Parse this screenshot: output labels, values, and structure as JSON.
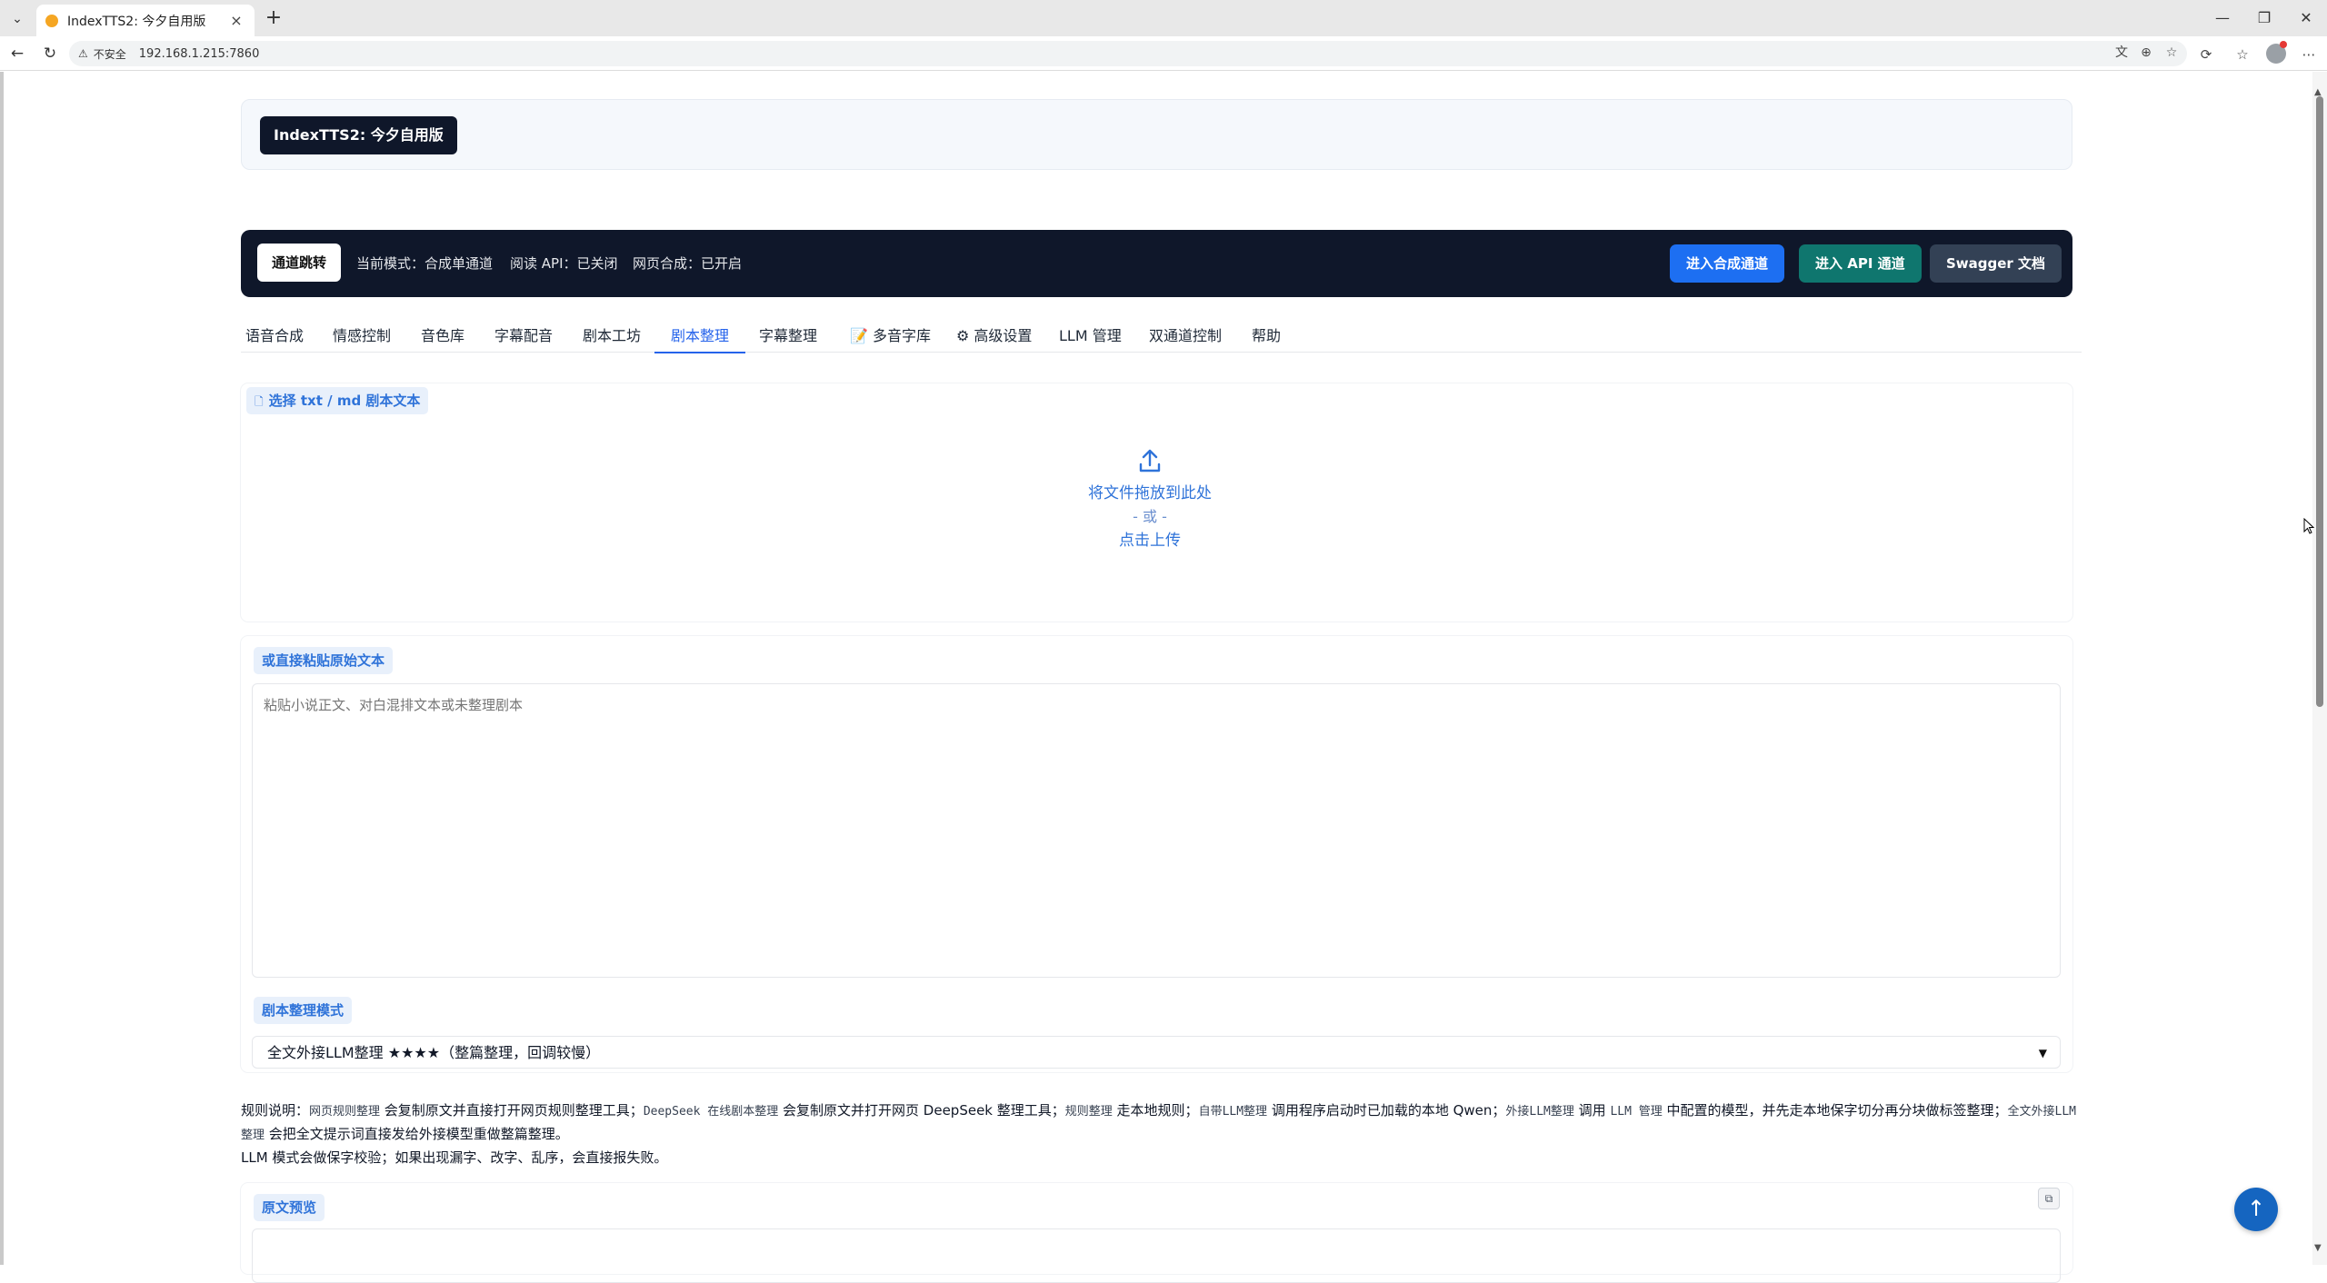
{
  "browser": {
    "tab_title": "IndexTTS2: 今夕自用版",
    "tab_close": "×",
    "new_tab": "+",
    "minimize": "—",
    "restore": "❐",
    "close": "✕",
    "insecure_label": "不安全",
    "url": "192.168.1.215:7860"
  },
  "header": {
    "brand": "IndexTTS2: 今夕自用版"
  },
  "channel_bar": {
    "jump_label": "通道跳转",
    "mode_text": "当前模式：合成单通道",
    "read_api_text": "阅读 API：已关闭",
    "web_synth_text": "网页合成：已开启",
    "btn_synth": "进入合成通道",
    "btn_api": "进入 API 通道",
    "btn_swagger": "Swagger 文档"
  },
  "tabs": [
    {
      "label": "语音合成"
    },
    {
      "label": "情感控制"
    },
    {
      "label": "音色库"
    },
    {
      "label": "字幕配音"
    },
    {
      "label": "剧本工坊"
    },
    {
      "label": "剧本整理",
      "active": true
    },
    {
      "label": "字幕整理"
    },
    {
      "label": "📝 多音字库"
    },
    {
      "label": "⚙ 高级设置"
    },
    {
      "label": "LLM 管理"
    },
    {
      "label": "双通道控制"
    },
    {
      "label": "帮助"
    }
  ],
  "upload": {
    "label": "选择 txt / md 剧本文本",
    "drop_text": "将文件拖放到此处",
    "or_text": "- 或 -",
    "click_text": "点击上传"
  },
  "paste": {
    "label": "或直接粘贴原始文本",
    "placeholder": "粘贴小说正文、对白混排文本或未整理剧本"
  },
  "mode": {
    "label": "剧本整理模式",
    "selected": "全文外接LLM整理 ★★★★（整篇整理，回调较慢）"
  },
  "rules": {
    "p1_prefix": "规则说明：",
    "c1": "网页规则整理",
    "t1": " 会复制原文并直接打开网页规则整理工具；",
    "c2": "DeepSeek 在线剧本整理",
    "t2": " 会复制原文并打开网页 DeepSeek 整理工具；",
    "c3": "规则整理",
    "t3": " 走本地规则；",
    "c4": "自带LLM整理",
    "t4": " 调用程序启动时已加载的本地 Qwen；",
    "c5": "外接LLM整理",
    "t5": " 调用 ",
    "c6": "LLM 管理",
    "t6": " 中配置的模型，并先走本地保字切分再分块做标签整理；",
    "c7": "全文外接LLM整理",
    "t7": " 会把全文提示词直接发给外接模型重做整篇整理。",
    "p2": "LLM 模式会做保字校验；如果出现漏字、改字、乱序，会直接报失败。"
  },
  "preview": {
    "label": "原文预览",
    "copy_icon": "⧉"
  },
  "to_top": "↑"
}
